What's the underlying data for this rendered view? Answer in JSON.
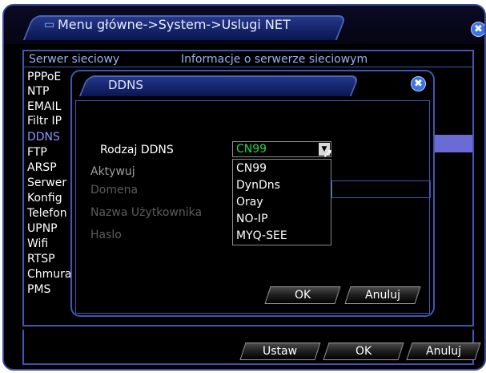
{
  "main": {
    "title_icon": "monitor-icon",
    "title": "Menu główne->System->Uslugi NET",
    "close": "✖",
    "header": {
      "server": "Serwer sieciowy",
      "info": "Informacje o serwerze sieciowym"
    },
    "services": [
      "PPPoE",
      "NTP",
      "EMAIL",
      "Filtr IP",
      "DDNS",
      "FTP",
      "ARSP",
      "Serwer",
      "Konfig",
      "Telefon",
      "UPNP",
      "Wifi",
      "RTSP",
      "Chmura",
      "PMS"
    ],
    "selected_service": "DDNS",
    "buttons": {
      "set": "Ustaw",
      "ok": "OK",
      "cancel": "Anuluj"
    }
  },
  "dialog": {
    "title": "DDNS",
    "close": "✖",
    "labels": {
      "type": "Rodzaj DDNS",
      "enable": "Aktywuj",
      "domain": "Domena",
      "user": "Nazwa Użytkownika",
      "password": "Haslo"
    },
    "type_value": "CN99",
    "options": [
      "CN99",
      "DynDns",
      "Oray",
      "NO-IP",
      "MYQ-SEE"
    ],
    "buttons": {
      "ok": "OK",
      "cancel": "Anuluj"
    }
  },
  "colors": {
    "accent_border": "#3f57b4",
    "selected_value": "#23d84a",
    "selected_service": "#8f93ff",
    "row_highlight": "#6b6bd6"
  }
}
